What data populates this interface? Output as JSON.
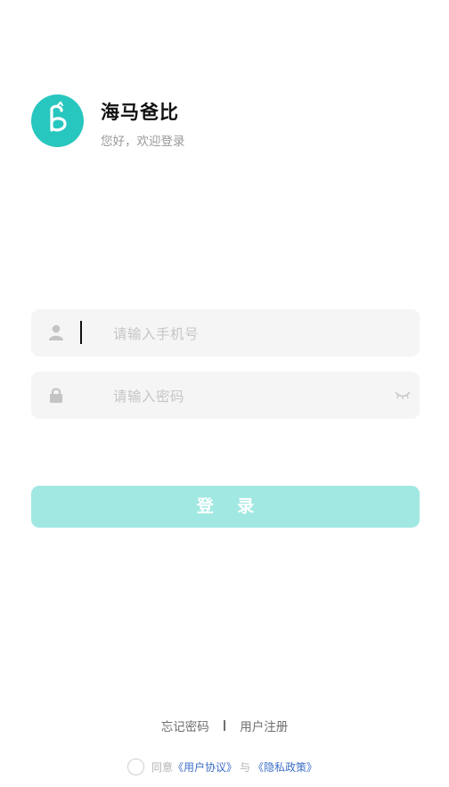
{
  "header": {
    "app_name": "海马爸比",
    "welcome": "您好，欢迎登录",
    "logo_icon": "seahorse-b-logo"
  },
  "form": {
    "phone_placeholder": "请输入手机号",
    "password_placeholder": "请输入密码",
    "phone_icon": "user-icon",
    "password_icon": "lock-icon",
    "toggle_icon": "eye-closed-icon"
  },
  "login_label": "登 录",
  "links": {
    "forgot": "忘记密码",
    "register": "用户注册"
  },
  "agreement": {
    "agree": "同意",
    "user_agreement": "《用户协议》",
    "and": "与",
    "privacy_policy": "《隐私政策》"
  },
  "colors": {
    "brand": "#27c6be",
    "button": "#a1e8e2",
    "link": "#3d6fc7"
  }
}
